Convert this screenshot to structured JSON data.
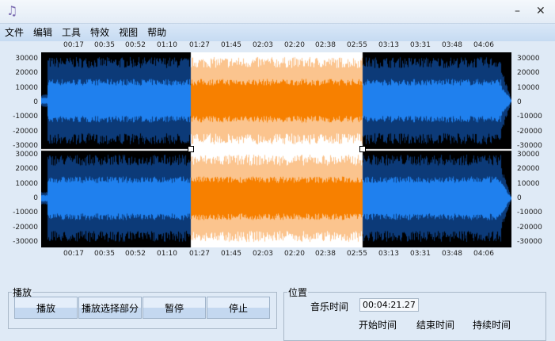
{
  "titlebar": {
    "icon": "music-note-icon",
    "minimize": "–",
    "close": "✕"
  },
  "menu": [
    "文件",
    "编辑",
    "工具",
    "特效",
    "视图",
    "帮助"
  ],
  "timeline": [
    "00:17",
    "00:35",
    "00:52",
    "01:10",
    "01:27",
    "01:45",
    "02:03",
    "02:20",
    "02:38",
    "02:55",
    "03:13",
    "03:31",
    "03:48",
    "04:06"
  ],
  "yaxis": [
    "30000",
    "20000",
    "10000",
    "0",
    "-10000",
    "-20000",
    "-30000"
  ],
  "colors": {
    "bg": "#000000",
    "wave_outer": "#0c3a78",
    "wave_inner": "#1f80ee",
    "sel_bg": "#ffffff",
    "sel_outer": "#fbc48e",
    "sel_inner": "#f78000"
  },
  "playback": {
    "title": "播放",
    "buttons": [
      "播放",
      "播放选择部分",
      "暂停",
      "停止"
    ]
  },
  "position": {
    "title": "位置",
    "music_time_label": "音乐时间",
    "music_time": "00:04:21.27",
    "start_label": "开始时间",
    "end_label": "结束时间",
    "duration_label": "持续时间"
  }
}
